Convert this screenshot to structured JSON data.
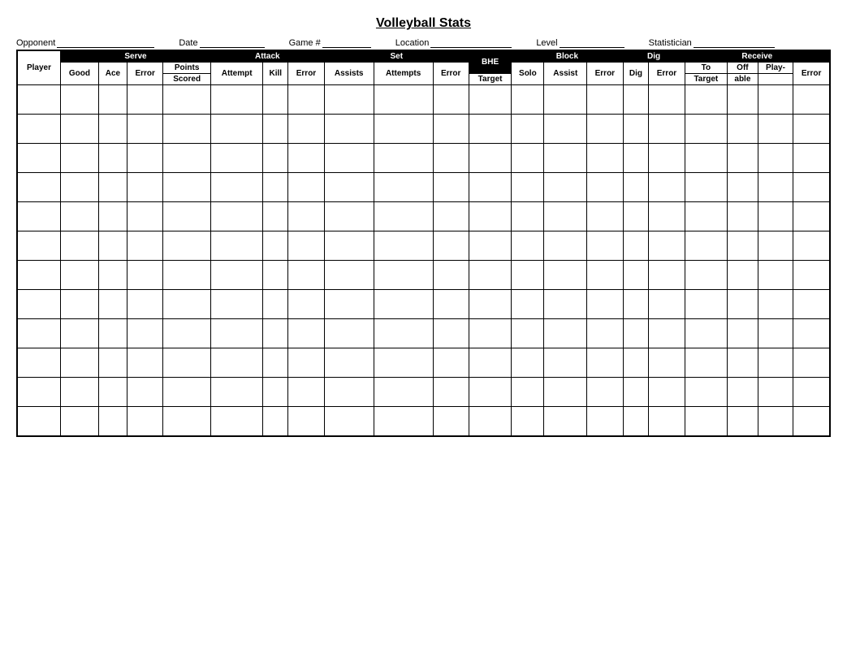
{
  "title": "Volleyball Stats",
  "info_fields": [
    {
      "label": "Opponent",
      "value": ""
    },
    {
      "label": "Date",
      "value": ""
    },
    {
      "label": "Game #",
      "value": ""
    },
    {
      "label": "Location",
      "value": ""
    },
    {
      "label": "Level",
      "value": ""
    },
    {
      "label": "Statistician",
      "value": ""
    }
  ],
  "table": {
    "section_headers": [
      {
        "label": "Serve",
        "colspan": 4
      },
      {
        "label": "Attack",
        "colspan": 3
      },
      {
        "label": "Set",
        "colspan": 3
      },
      {
        "label": "BHE",
        "colspan": 1
      },
      {
        "label": "Block",
        "colspan": 3
      },
      {
        "label": "Dig",
        "colspan": 2
      },
      {
        "label": "Receive",
        "colspan": 4
      }
    ],
    "col_headers_row1": [
      {
        "label": "Player",
        "rowspan": 2
      },
      {
        "label": "Good",
        "rowspan": 2
      },
      {
        "label": "Ace",
        "rowspan": 2
      },
      {
        "label": "Error",
        "rowspan": 2
      },
      {
        "label": "Points",
        "rowspan": 1
      },
      {
        "label": "Attempt",
        "rowspan": 2
      },
      {
        "label": "Kill",
        "rowspan": 2
      },
      {
        "label": "Error",
        "rowspan": 2
      },
      {
        "label": "Assists",
        "rowspan": 2
      },
      {
        "label": "Attempts",
        "rowspan": 2
      },
      {
        "label": "Error",
        "rowspan": 2
      },
      {
        "label": "BHE",
        "rowspan": 2
      },
      {
        "label": "Solo",
        "rowspan": 2
      },
      {
        "label": "Assist",
        "rowspan": 2
      },
      {
        "label": "Error",
        "rowspan": 2
      },
      {
        "label": "Dig",
        "rowspan": 2
      },
      {
        "label": "Error",
        "rowspan": 2
      },
      {
        "label": "To Target",
        "rowspan": 1
      },
      {
        "label": "Off Target",
        "rowspan": 1
      },
      {
        "label": "Play-able",
        "rowspan": 1
      },
      {
        "label": "Error",
        "rowspan": 2
      }
    ],
    "col_headers_row2": [
      {
        "label": "Scored"
      },
      {
        "label": "Target"
      },
      {
        "label": "Target"
      },
      {
        "label": "able"
      }
    ],
    "num_data_rows": 12
  }
}
